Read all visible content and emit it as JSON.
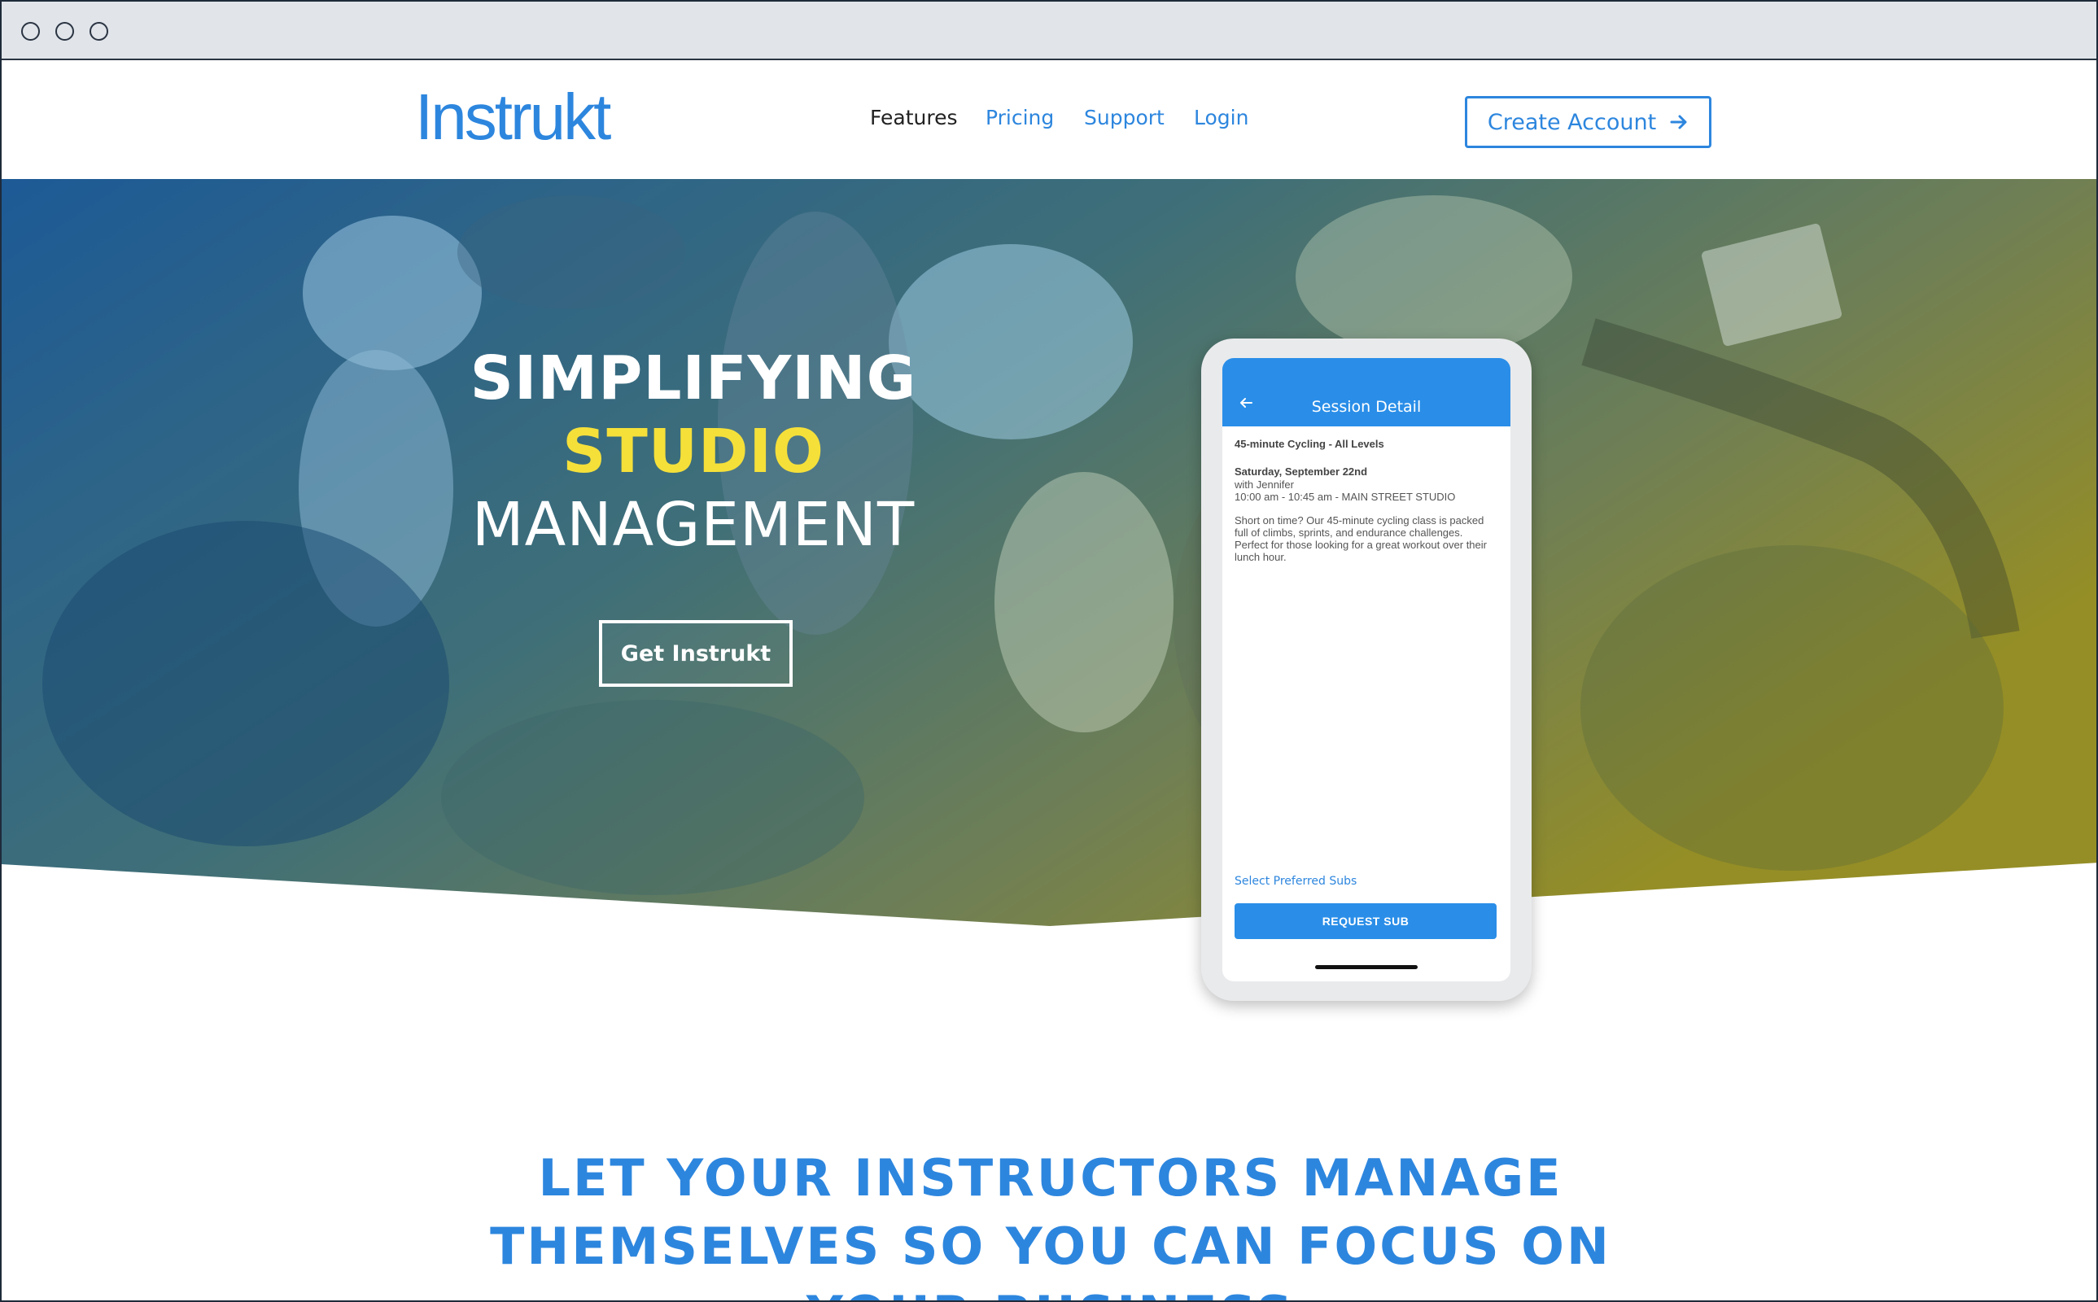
{
  "nav": {
    "logo": "Instrukt",
    "links": [
      {
        "label": "Features"
      },
      {
        "label": "Pricing"
      },
      {
        "label": "Support"
      },
      {
        "label": "Login"
      }
    ],
    "create_account": "Create Account"
  },
  "hero": {
    "headline_line1": "SIMPLIFYING",
    "headline_line2": "STUDIO",
    "headline_line3": "MANAGEMENT",
    "cta": "Get Instrukt"
  },
  "phone": {
    "screen_title": "Session Detail",
    "class_name": "45-minute Cycling - All Levels",
    "date": "Saturday, September 22nd",
    "instructor": "with Jennifer",
    "time_location": "10:00 am - 10:45 am - MAIN STREET STUDIO",
    "description": "Short on time? Our 45-minute cycling class is packed full of climbs, sprints, and endurance challenges. Perfect for those looking for a great workout over their lunch hour.",
    "subs_link": "Select Preferred Subs",
    "request_button": "REQUEST SUB"
  },
  "section": {
    "heading": "LET YOUR INSTRUCTORS MANAGE THEMSELVES SO YOU CAN FOCUS ON YOUR BUSINESS"
  },
  "colors": {
    "brand_blue": "#2d86de",
    "highlight_yellow": "#f5e03a",
    "hero_overlay_left": "#1f5f9a",
    "hero_overlay_right": "#8c8a2e"
  },
  "icons": {
    "create_account_arrow": "arrow-right-icon",
    "back": "arrow-left-icon"
  }
}
